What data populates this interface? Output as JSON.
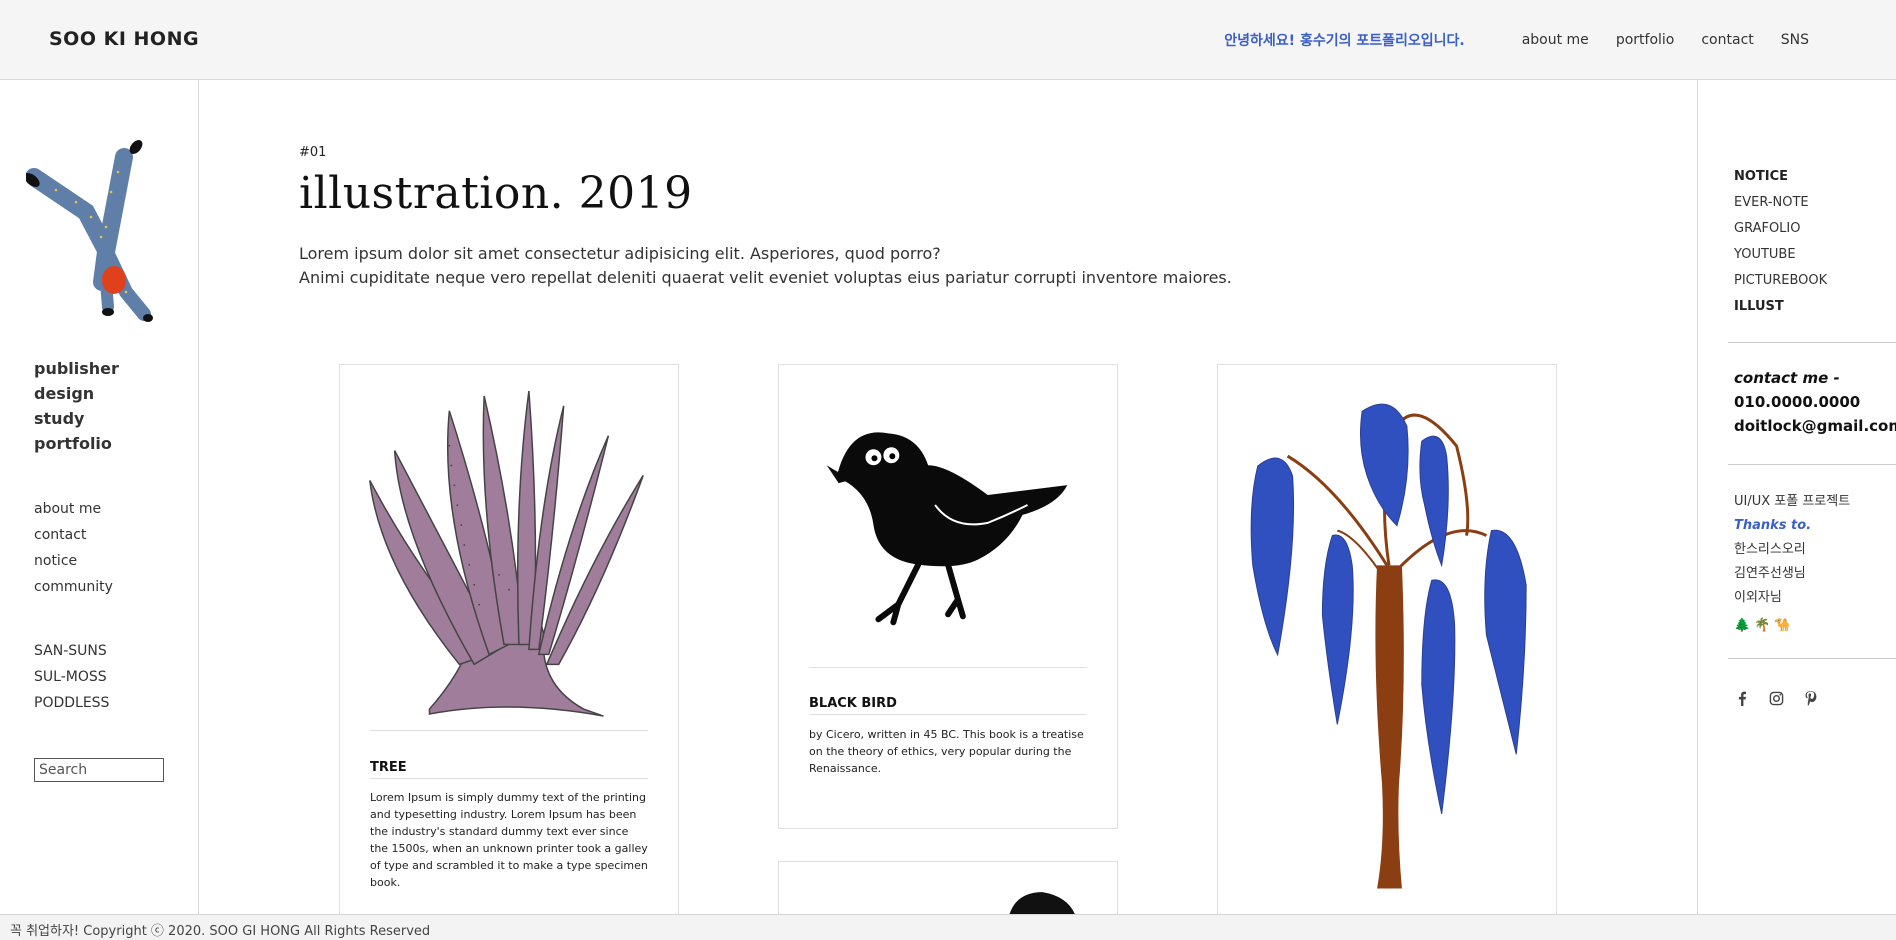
{
  "header": {
    "brand": "SOO KI HONG",
    "greeting": "안녕하세요! 홍수기의 포트폴리오입니다.",
    "nav": [
      "about me",
      "portfolio",
      "contact",
      "SNS"
    ]
  },
  "left": {
    "categories": [
      "publisher",
      "design",
      "study",
      "portfolio"
    ],
    "links1": [
      "about me",
      "contact",
      "notice",
      "community"
    ],
    "links2": [
      "SAN-SUNS",
      "SUL-MOSS",
      "PODDLESS"
    ],
    "search_placeholder": "Search"
  },
  "main": {
    "kicker": "#01",
    "title": "illustration. 2019",
    "lead1": "Lorem ipsum dolor sit amet consectetur adipisicing elit. Asperiores, quod porro?",
    "lead2": "Animi cupiditate neque vero repellat deleniti quaerat velit eveniet voluptas eius pariatur corrupti inventore maiores.",
    "cards": [
      {
        "name": "TREE",
        "desc": "Lorem Ipsum is simply dummy text of the printing and typesetting industry. Lorem Ipsum has been the industry's standard dummy text ever since the 1500s, when an unknown printer took a galley of type and scrambled it to make a type specimen book."
      },
      {
        "name": "BLACK BIRD",
        "desc": "by Cicero, written in 45 BC. This book is a treatise on the theory of ethics, very popular during the Renaissance."
      },
      {
        "name": "",
        "desc": ""
      }
    ]
  },
  "right": {
    "nav": [
      "NOTICE",
      "EVER-NOTE",
      "GRAFOLIO",
      "YOUTUBE",
      "PICTUREBOOK",
      "ILLUST"
    ],
    "contact_label": "contact me -",
    "phone": "010.0000.0000",
    "email": "doitlock@gmail.com",
    "project": "UI/UX 포폴 프로젝트",
    "thanks": "Thanks to.",
    "people": [
      "한스리스오리",
      "김연주선생님",
      "이외자님"
    ],
    "emojis": [
      "🌲",
      "🌴",
      "🐪"
    ],
    "social_icons": [
      "facebook-icon",
      "instagram-icon",
      "pinterest-icon"
    ]
  },
  "footer": {
    "text": "꼭 취업하자! Copyright ⓒ 2020. SOO GI HONG All Rights Reserved"
  },
  "colors": {
    "accent": "#3a5fc8",
    "plant": "#a07d9a",
    "tree_leaf": "#3050c0",
    "trunk": "#8a3e12"
  }
}
